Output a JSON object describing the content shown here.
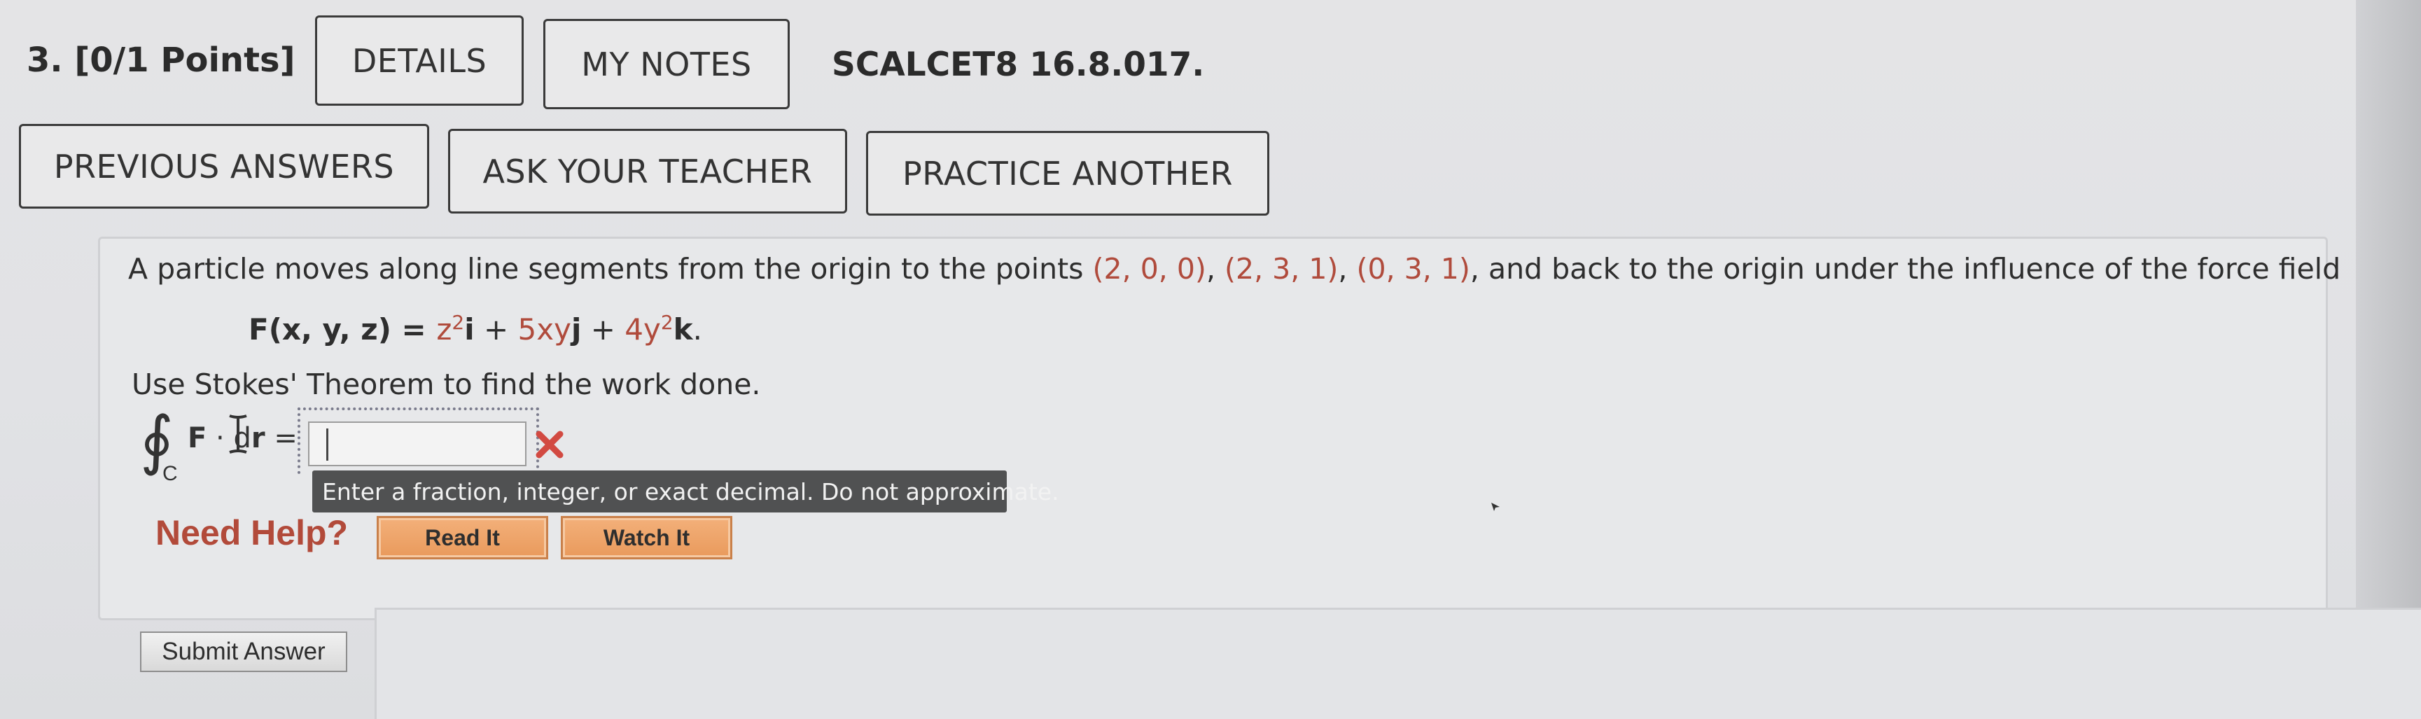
{
  "question": {
    "number_points": "3. [0/1 Points]",
    "assignment_ref": "SCALCET8 16.8.017."
  },
  "toolbar": {
    "details": "DETAILS",
    "my_notes": "MY NOTES",
    "previous_answers": "PREVIOUS ANSWERS",
    "ask_teacher": "ASK YOUR TEACHER",
    "practice_another": "PRACTICE ANOTHER"
  },
  "problem": {
    "text_start": "A particle moves along line segments from the origin to the points ",
    "points": [
      "(2, 0, 0)",
      "(2, 3, 1)",
      "(0, 3, 1)"
    ],
    "sep1": ", ",
    "sep2": ", ",
    "sep3": ", and back to the origin under the influence of the force field",
    "formula_lhs": "F(x, y, z) = ",
    "formula_t1": "z",
    "formula_t1_exp": "2",
    "formula_t1_vec": "i",
    "formula_plus1": " + ",
    "formula_t2": "5xy",
    "formula_t2_vec": "j",
    "formula_plus2": " + ",
    "formula_t3": "4y",
    "formula_t3_exp": "2",
    "formula_t3_vec": "k",
    "formula_end": ".",
    "instruction": "Use Stokes' Theorem to find the work done."
  },
  "answer": {
    "integral_symbol": "∮",
    "integral_sub": "C",
    "integrand_f": "F",
    "integrand_dot": " · ",
    "integrand_d": "d",
    "integrand_r": "r",
    "equals": " =",
    "value": "",
    "hint": "Enter a fraction, integer, or exact decimal. Do not approximate."
  },
  "help": {
    "label": "Need Help?",
    "read_it": "Read It",
    "watch_it": "Watch It"
  },
  "submit": {
    "label": "Submit Answer"
  },
  "colors": {
    "point_text": "#b04b3c",
    "need_help": "#b24a3a",
    "help_button": "#e99a5c",
    "wrong_mark": "#d24a42"
  }
}
